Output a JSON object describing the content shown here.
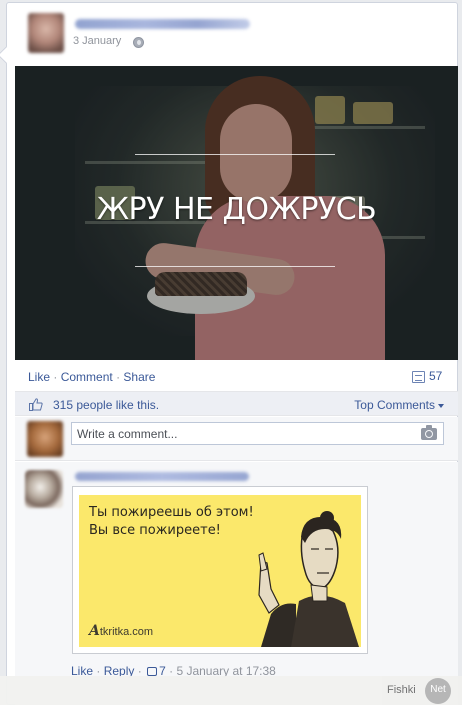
{
  "post": {
    "date": "3 January",
    "photo_caption": "ЖРУ НЕ ДОЖРУСЬ"
  },
  "actions": {
    "like": "Like",
    "comment": "Comment",
    "share": "Share",
    "separator": "·",
    "comments_count": "57"
  },
  "likes": {
    "summary": "315 people like this.",
    "top_comments": "Top Comments"
  },
  "composer": {
    "placeholder": "Write a comment..."
  },
  "comment": {
    "ecard_text": "Ты пожиреешь об этом! Вы все пожиреете!",
    "ecard_brand_initial": "A",
    "ecard_brand_rest": "tkritka.com",
    "like": "Like",
    "reply": "Reply",
    "separator": "·",
    "likes_count": "7",
    "timestamp": "5 January at 17:38"
  },
  "watermark": {
    "text": "Fishki",
    "badge": "Net"
  },
  "colors": {
    "link": "#3b5998",
    "muted": "#90949c",
    "ecard_yellow": "#fbe86b"
  }
}
